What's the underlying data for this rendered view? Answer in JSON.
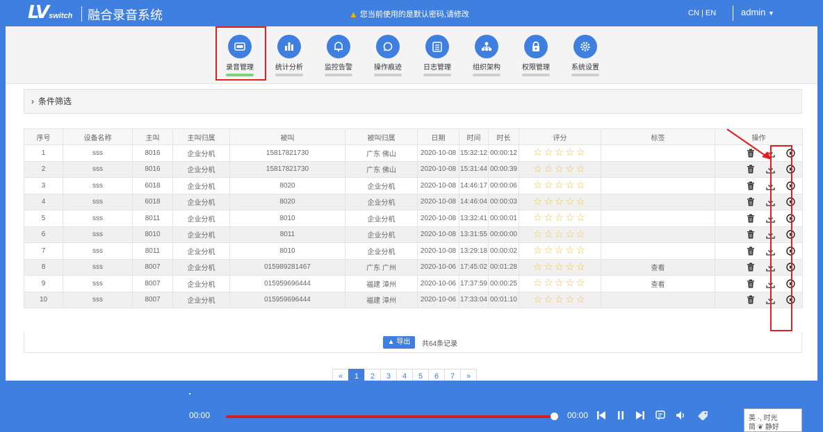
{
  "header": {
    "logo_main": "LV",
    "logo_sub": "switch",
    "system_title": "融合录音系统",
    "warning": "您当前使用的是默认密码,请修改",
    "lang": "CN | EN",
    "user": "admin"
  },
  "nav": [
    {
      "label": "录音管理",
      "icon": "recording-icon",
      "active": true
    },
    {
      "label": "统计分析",
      "icon": "bar-chart-icon",
      "active": false
    },
    {
      "label": "监控告警",
      "icon": "bell-icon",
      "active": false
    },
    {
      "label": "操作痕迹",
      "icon": "search-icon",
      "active": false
    },
    {
      "label": "日志管理",
      "icon": "log-icon",
      "active": false
    },
    {
      "label": "组织架构",
      "icon": "org-icon",
      "active": false
    },
    {
      "label": "权限管理",
      "icon": "lock-icon",
      "active": false
    },
    {
      "label": "系统设置",
      "icon": "gear-icon",
      "active": false
    }
  ],
  "filter": {
    "label": "条件筛选"
  },
  "table": {
    "headers": [
      "序号",
      "设备名称",
      "主叫",
      "主叫归属",
      "被叫",
      "被叫归属",
      "日期",
      "时间",
      "时长",
      "评分",
      "标签",
      "操作"
    ],
    "rows": [
      {
        "no": "1",
        "device": "sss",
        "caller": "8016",
        "caller_area": "企业分机",
        "callee": "15817821730",
        "callee_area": "广东 佛山",
        "date": "2020-10-08",
        "time": "15:32:12",
        "duration": "00:00:12",
        "rating": "☆☆☆☆☆",
        "tag": ""
      },
      {
        "no": "2",
        "device": "sss",
        "caller": "8016",
        "caller_area": "企业分机",
        "callee": "15817821730",
        "callee_area": "广东 佛山",
        "date": "2020-10-08",
        "time": "15:31:44",
        "duration": "00:00:39",
        "rating": "☆☆☆☆☆",
        "tag": ""
      },
      {
        "no": "3",
        "device": "sss",
        "caller": "6018",
        "caller_area": "企业分机",
        "callee": "8020",
        "callee_area": "企业分机",
        "date": "2020-10-08",
        "time": "14:46:17",
        "duration": "00:00:06",
        "rating": "☆☆☆☆☆",
        "tag": ""
      },
      {
        "no": "4",
        "device": "sss",
        "caller": "6018",
        "caller_area": "企业分机",
        "callee": "8020",
        "callee_area": "企业分机",
        "date": "2020-10-08",
        "time": "14:46:04",
        "duration": "00:00:03",
        "rating": "☆☆☆☆☆",
        "tag": ""
      },
      {
        "no": "5",
        "device": "sss",
        "caller": "8011",
        "caller_area": "企业分机",
        "callee": "8010",
        "callee_area": "企业分机",
        "date": "2020-10-08",
        "time": "13:32:41",
        "duration": "00:00:01",
        "rating": "☆☆☆☆☆",
        "tag": ""
      },
      {
        "no": "6",
        "device": "sss",
        "caller": "8010",
        "caller_area": "企业分机",
        "callee": "8011",
        "callee_area": "企业分机",
        "date": "2020-10-08",
        "time": "13:31:55",
        "duration": "00:00:00",
        "rating": "☆☆☆☆☆",
        "tag": ""
      },
      {
        "no": "7",
        "device": "sss",
        "caller": "8011",
        "caller_area": "企业分机",
        "callee": "8010",
        "callee_area": "企业分机",
        "date": "2020-10-08",
        "time": "13:29:18",
        "duration": "00:00:02",
        "rating": "☆☆☆☆☆",
        "tag": ""
      },
      {
        "no": "8",
        "device": "sss",
        "caller": "8007",
        "caller_area": "企业分机",
        "callee": "015989281467",
        "callee_area": "广东 广州",
        "date": "2020-10-06",
        "time": "17:45:02",
        "duration": "00:01:28",
        "rating": "☆☆☆☆☆",
        "tag": "查看"
      },
      {
        "no": "9",
        "device": "sss",
        "caller": "8007",
        "caller_area": "企业分机",
        "callee": "015959696444",
        "callee_area": "福建 漳州",
        "date": "2020-10-06",
        "time": "17:37:59",
        "duration": "00:00:25",
        "rating": "☆☆☆☆☆",
        "tag": "查看"
      },
      {
        "no": "10",
        "device": "sss",
        "caller": "8007",
        "caller_area": "企业分机",
        "callee": "015959696444",
        "callee_area": "福建 漳州",
        "date": "2020-10-06",
        "time": "17:33:04",
        "duration": "00:01:10",
        "rating": "☆☆☆☆☆",
        "tag": ""
      }
    ]
  },
  "footer": {
    "export_label": "导出",
    "total": "共64条记录"
  },
  "pagination": {
    "prev": "«",
    "pages": [
      "1",
      "2",
      "3",
      "4",
      "5",
      "6",
      "7"
    ],
    "current": "1",
    "next": "»"
  },
  "player": {
    "current": "00:00",
    "end": "00:00",
    "progress": 0.99
  },
  "stamp": {
    "line1": "英 ·, 时光",
    "line2": "简 ❦ 静好"
  },
  "colors": {
    "primary": "#3f7fe0",
    "annotation": "#e02020",
    "star": "#f7c340",
    "active_tab": "#7ed27e"
  }
}
